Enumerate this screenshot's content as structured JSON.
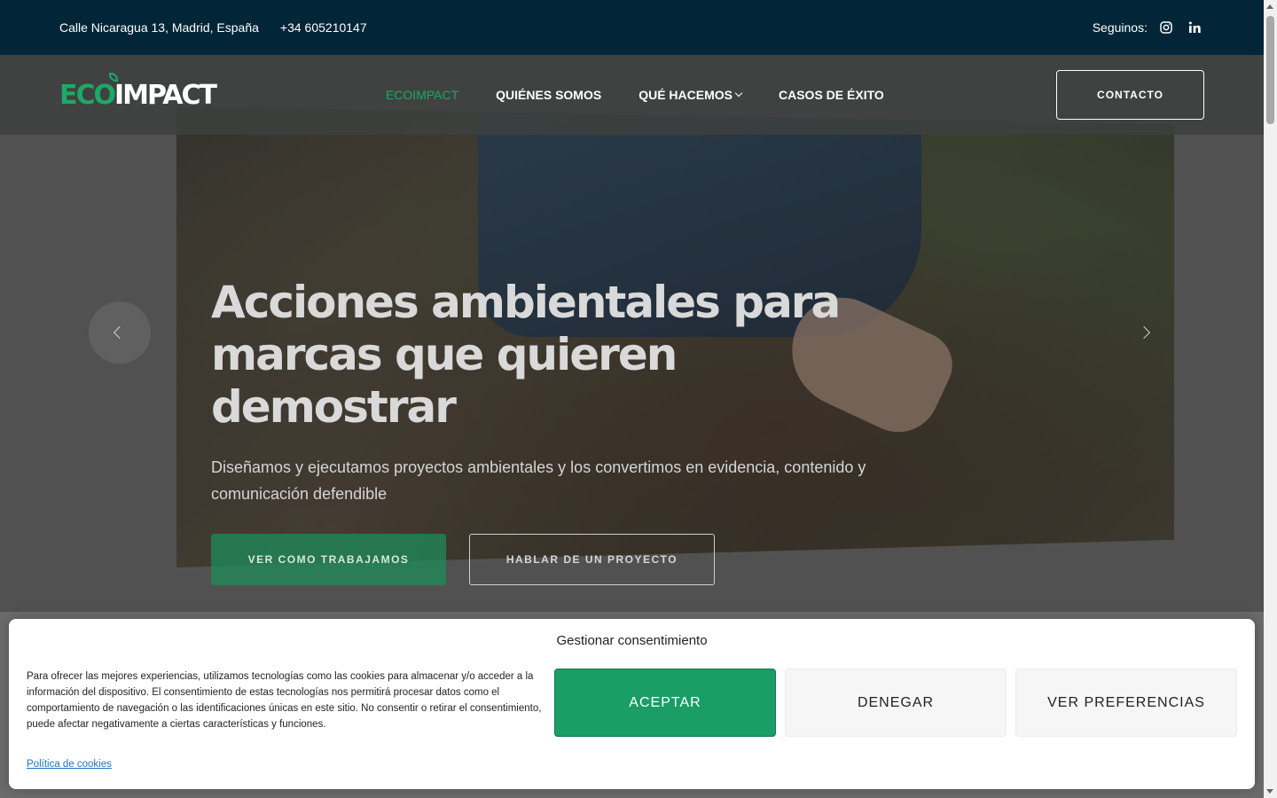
{
  "topbar": {
    "address": "Calle Nicaragua 13, Madrid, España",
    "phone": "+34 605210147",
    "follow_label": "Seguinos:",
    "socials": [
      "instagram-icon",
      "linkedin-icon"
    ]
  },
  "nav": {
    "logo_eco": "ECO",
    "logo_impact": "IMPACT",
    "items": [
      {
        "label": "ECOIMPACT",
        "active": true
      },
      {
        "label": "QUIÉNES SOMOS"
      },
      {
        "label": "QUÉ HACEMOS",
        "dropdown": true
      },
      {
        "label": "CASOS DE ÉXITO"
      }
    ],
    "contact_label": "CONTACTO"
  },
  "hero": {
    "title": "Acciones ambientales para marcas que quieren demostrar",
    "subtitle": "Diseñamos y ejecutamos proyectos ambientales y los convertimos en evidencia, contenido y comunicación defendible",
    "primary_cta": "VER COMO TRABAJAMOS",
    "secondary_cta": "HABLAR DE UN PROYECTO"
  },
  "cookie": {
    "title": "Gestionar consentimiento",
    "message": "Para ofrecer las mejores experiencias, utilizamos tecnologías como las cookies para almacenar y/o acceder a la información del dispositivo. El consentimiento de estas tecnologías nos permitirá procesar datos como el comportamiento de navegación o las identificaciones únicas en este sitio. No consentir o retirar el consentimiento, puede afectar negativamente a ciertas características y funciones.",
    "accept": "ACEPTAR",
    "deny": "DENEGAR",
    "preferences": "VER PREFERENCIAS",
    "policy_link": "Política de cookies"
  },
  "colors": {
    "brand_green": "#1ea867",
    "topbar_bg": "#022637",
    "accept_bg": "#1a9e66"
  }
}
